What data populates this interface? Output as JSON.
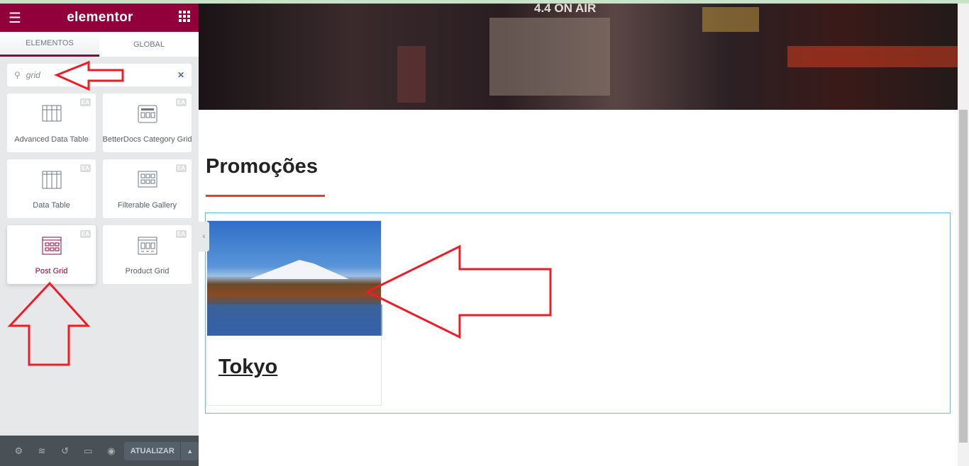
{
  "panel": {
    "logo": "elementor",
    "tabs": [
      {
        "label": "ELEMENTOS",
        "active": true
      },
      {
        "label": "GLOBAL",
        "active": false
      }
    ],
    "search": {
      "value": "grid"
    },
    "widgets": [
      {
        "label": "Advanced Data Table",
        "badge": "EA",
        "icon": "advanced-table-icon"
      },
      {
        "label": "BetterDocs Category Grid",
        "badge": "EA",
        "icon": "category-grid-icon"
      },
      {
        "label": "Data Table",
        "badge": "EA",
        "icon": "data-table-icon"
      },
      {
        "label": "Filterable Gallery",
        "badge": "EA",
        "icon": "gallery-icon"
      },
      {
        "label": "Post Grid",
        "badge": "EA",
        "icon": "post-grid-icon",
        "highlighted": true
      },
      {
        "label": "Product Grid",
        "badge": "EA",
        "icon": "product-grid-icon"
      }
    ],
    "footer": {
      "update_label": "ATUALIZAR"
    }
  },
  "main": {
    "hero_text": "4.4 ON AIR",
    "heading": "Promoções",
    "post": {
      "title": "Tokyo"
    }
  },
  "colors": {
    "brand": "#92003b",
    "accent_line": "#e2412a",
    "annotation": "#ee1c25"
  }
}
